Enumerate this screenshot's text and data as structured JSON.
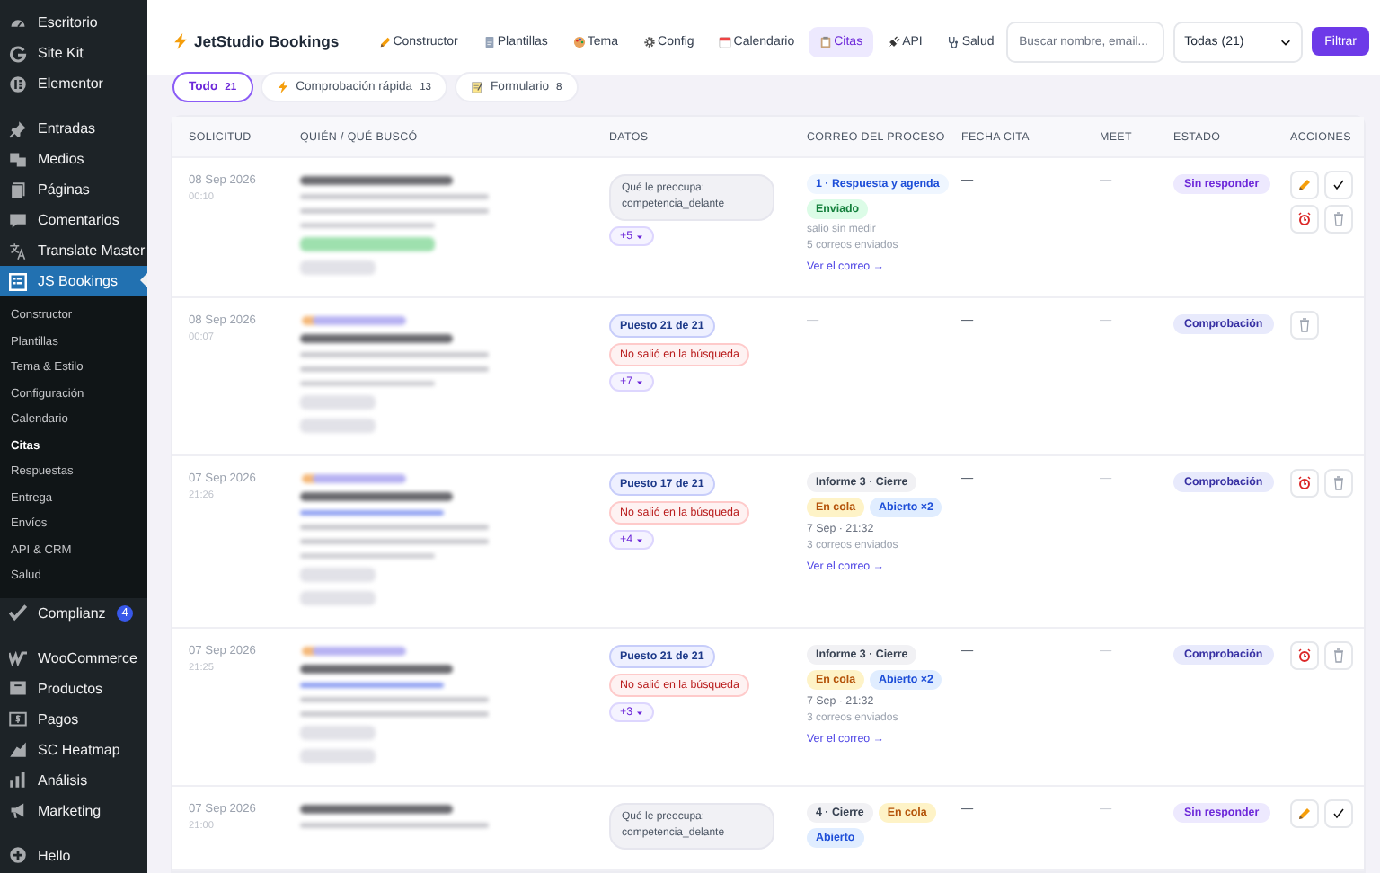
{
  "sidebar": {
    "groups": [
      [
        {
          "label": "Escritorio",
          "selected": false
        },
        {
          "label": "Site Kit",
          "selected": false
        },
        {
          "label": "Elementor",
          "selected": false
        }
      ],
      [
        {
          "label": "Entradas",
          "selected": false
        },
        {
          "label": "Medios",
          "selected": false
        },
        {
          "label": "Páginas",
          "selected": false
        },
        {
          "label": "Comentarios",
          "selected": false
        },
        {
          "label": "Translate Master",
          "selected": false
        },
        {
          "label": "JS Bookings",
          "selected": true,
          "submenu": [
            {
              "label": "Constructor",
              "selected": false
            },
            {
              "label": "Plantillas",
              "selected": false
            },
            {
              "label": "Tema & Estilo",
              "selected": false
            },
            {
              "label": "Configuración",
              "selected": false
            },
            {
              "label": "Calendario",
              "selected": false
            },
            {
              "label": "Citas",
              "selected": true
            },
            {
              "label": "Respuestas",
              "selected": false
            },
            {
              "label": "Entrega",
              "selected": false
            },
            {
              "label": "Envíos",
              "selected": false
            },
            {
              "label": "API & CRM",
              "selected": false
            },
            {
              "label": "Salud",
              "selected": false
            }
          ]
        }
      ],
      [
        {
          "label": "Complianz",
          "selected": false,
          "badge": "4"
        }
      ],
      [
        {
          "label": "WooCommerce",
          "selected": false
        },
        {
          "label": "Productos",
          "selected": false
        },
        {
          "label": "Pagos",
          "selected": false
        },
        {
          "label": "SC Heatmap",
          "selected": false
        },
        {
          "label": "Análisis",
          "selected": false
        },
        {
          "label": "Marketing",
          "selected": false
        }
      ],
      [
        {
          "label": "Hello",
          "selected": false
        }
      ]
    ]
  },
  "header": {
    "brand": "JetStudio Bookings",
    "tabs": [
      {
        "label": "Constructor",
        "selected": false
      },
      {
        "label": "Plantillas",
        "selected": false
      },
      {
        "label": "Tema",
        "selected": false
      },
      {
        "label": "Config",
        "selected": false
      },
      {
        "label": "Calendario",
        "selected": false
      },
      {
        "label": "Citas",
        "selected": true
      },
      {
        "label": "API",
        "selected": false
      },
      {
        "label": "Salud",
        "selected": false
      }
    ],
    "search": {
      "placeholder": "Buscar nombre, email..."
    },
    "select": {
      "value": "Todas (21)"
    },
    "button": "Filtrar"
  },
  "filters": [
    {
      "label": "Todo",
      "count": "21",
      "selected": true
    },
    {
      "label": "Comprobación rápida",
      "count": "13",
      "selected": false
    },
    {
      "label": "Formulario",
      "count": "8",
      "selected": false
    }
  ],
  "table": {
    "columns": [
      "SOLICITUD",
      "QUIÉN / QUÉ BUSCÓ",
      "DATOS",
      "CORREO DEL PROCESO",
      "FECHA CITA",
      "MEET",
      "ESTADO",
      "ACCIONES"
    ],
    "rows": [
      {
        "date": "08 Sep 2026",
        "time": "00:10",
        "data": [
          {
            "kind": "question",
            "text": "Qué le preocupa: competencia_delante"
          }
        ],
        "more": "+5",
        "mail": [
          {
            "kind": "step",
            "text": "1 · Respuesta y agenda"
          },
          {
            "kind": "sent",
            "text": "Enviado"
          },
          {
            "kind": "note",
            "text": "salio sin medir"
          },
          {
            "kind": "note",
            "text": "5 correos enviados"
          },
          {
            "kind": "link",
            "text": "Ver el correo →"
          }
        ],
        "appointment": "—",
        "meet": "—",
        "status": {
          "kind": "pending",
          "text": "Sin responder"
        },
        "actions": {
          "edit": true,
          "done": true,
          "reminder": true,
          "delete": true
        }
      },
      {
        "date": "08 Sep 2026",
        "time": "00:07",
        "data": [
          {
            "kind": "rank",
            "text": "Puesto 21 de 21"
          },
          {
            "kind": "miss",
            "text": "No salió en la búsqueda"
          }
        ],
        "more": "+7",
        "mail": [
          {
            "kind": "empty",
            "text": "—"
          }
        ],
        "appointment": "—",
        "meet": "—",
        "status": {
          "kind": "check",
          "text": "Comprobación"
        },
        "actions": {
          "delete": true
        }
      },
      {
        "date": "07 Sep 2026",
        "time": "21:26",
        "data": [
          {
            "kind": "rank",
            "text": "Puesto 17 de 21"
          },
          {
            "kind": "miss",
            "text": "No salió en la búsqueda"
          }
        ],
        "more": "+4",
        "mail": [
          {
            "kind": "stage",
            "text": "Informe 3 · Cierre"
          },
          {
            "kind": "queued",
            "text": "En cola"
          },
          {
            "kind": "opened",
            "text": "Abierto ×2"
          },
          {
            "kind": "time",
            "text": "7 Sep · 21:32"
          },
          {
            "kind": "note",
            "text": "3 correos enviados"
          },
          {
            "kind": "link",
            "text": "Ver el correo →"
          }
        ],
        "appointment": "—",
        "meet": "—",
        "status": {
          "kind": "check",
          "text": "Comprobación"
        },
        "actions": {
          "reminder": true,
          "delete": true
        }
      },
      {
        "date": "07 Sep 2026",
        "time": "21:25",
        "data": [
          {
            "kind": "rank",
            "text": "Puesto 21 de 21"
          },
          {
            "kind": "miss",
            "text": "No salió en la búsqueda"
          }
        ],
        "more": "+3",
        "mail": [
          {
            "kind": "stage",
            "text": "Informe 3 · Cierre"
          },
          {
            "kind": "queued",
            "text": "En cola"
          },
          {
            "kind": "opened",
            "text": "Abierto ×2"
          },
          {
            "kind": "time",
            "text": "7 Sep · 21:32"
          },
          {
            "kind": "note",
            "text": "3 correos enviados"
          },
          {
            "kind": "link",
            "text": "Ver el correo →"
          }
        ],
        "appointment": "—",
        "meet": "—",
        "status": {
          "kind": "check",
          "text": "Comprobación"
        },
        "actions": {
          "reminder": true,
          "delete": true
        }
      },
      {
        "date": "07 Sep 2026",
        "time": "21:00",
        "data": [
          {
            "kind": "question",
            "text": "Qué le preocupa: competencia_delante"
          }
        ],
        "mail": [
          {
            "kind": "stage",
            "text": "4 · Cierre"
          },
          {
            "kind": "queued",
            "text": "En cola"
          },
          {
            "kind": "opened",
            "text": "Abierto"
          }
        ],
        "appointment": "—",
        "meet": "—",
        "status": {
          "kind": "pending",
          "text": "Sin responder"
        },
        "actions": {
          "edit": true,
          "done": true
        }
      }
    ]
  }
}
